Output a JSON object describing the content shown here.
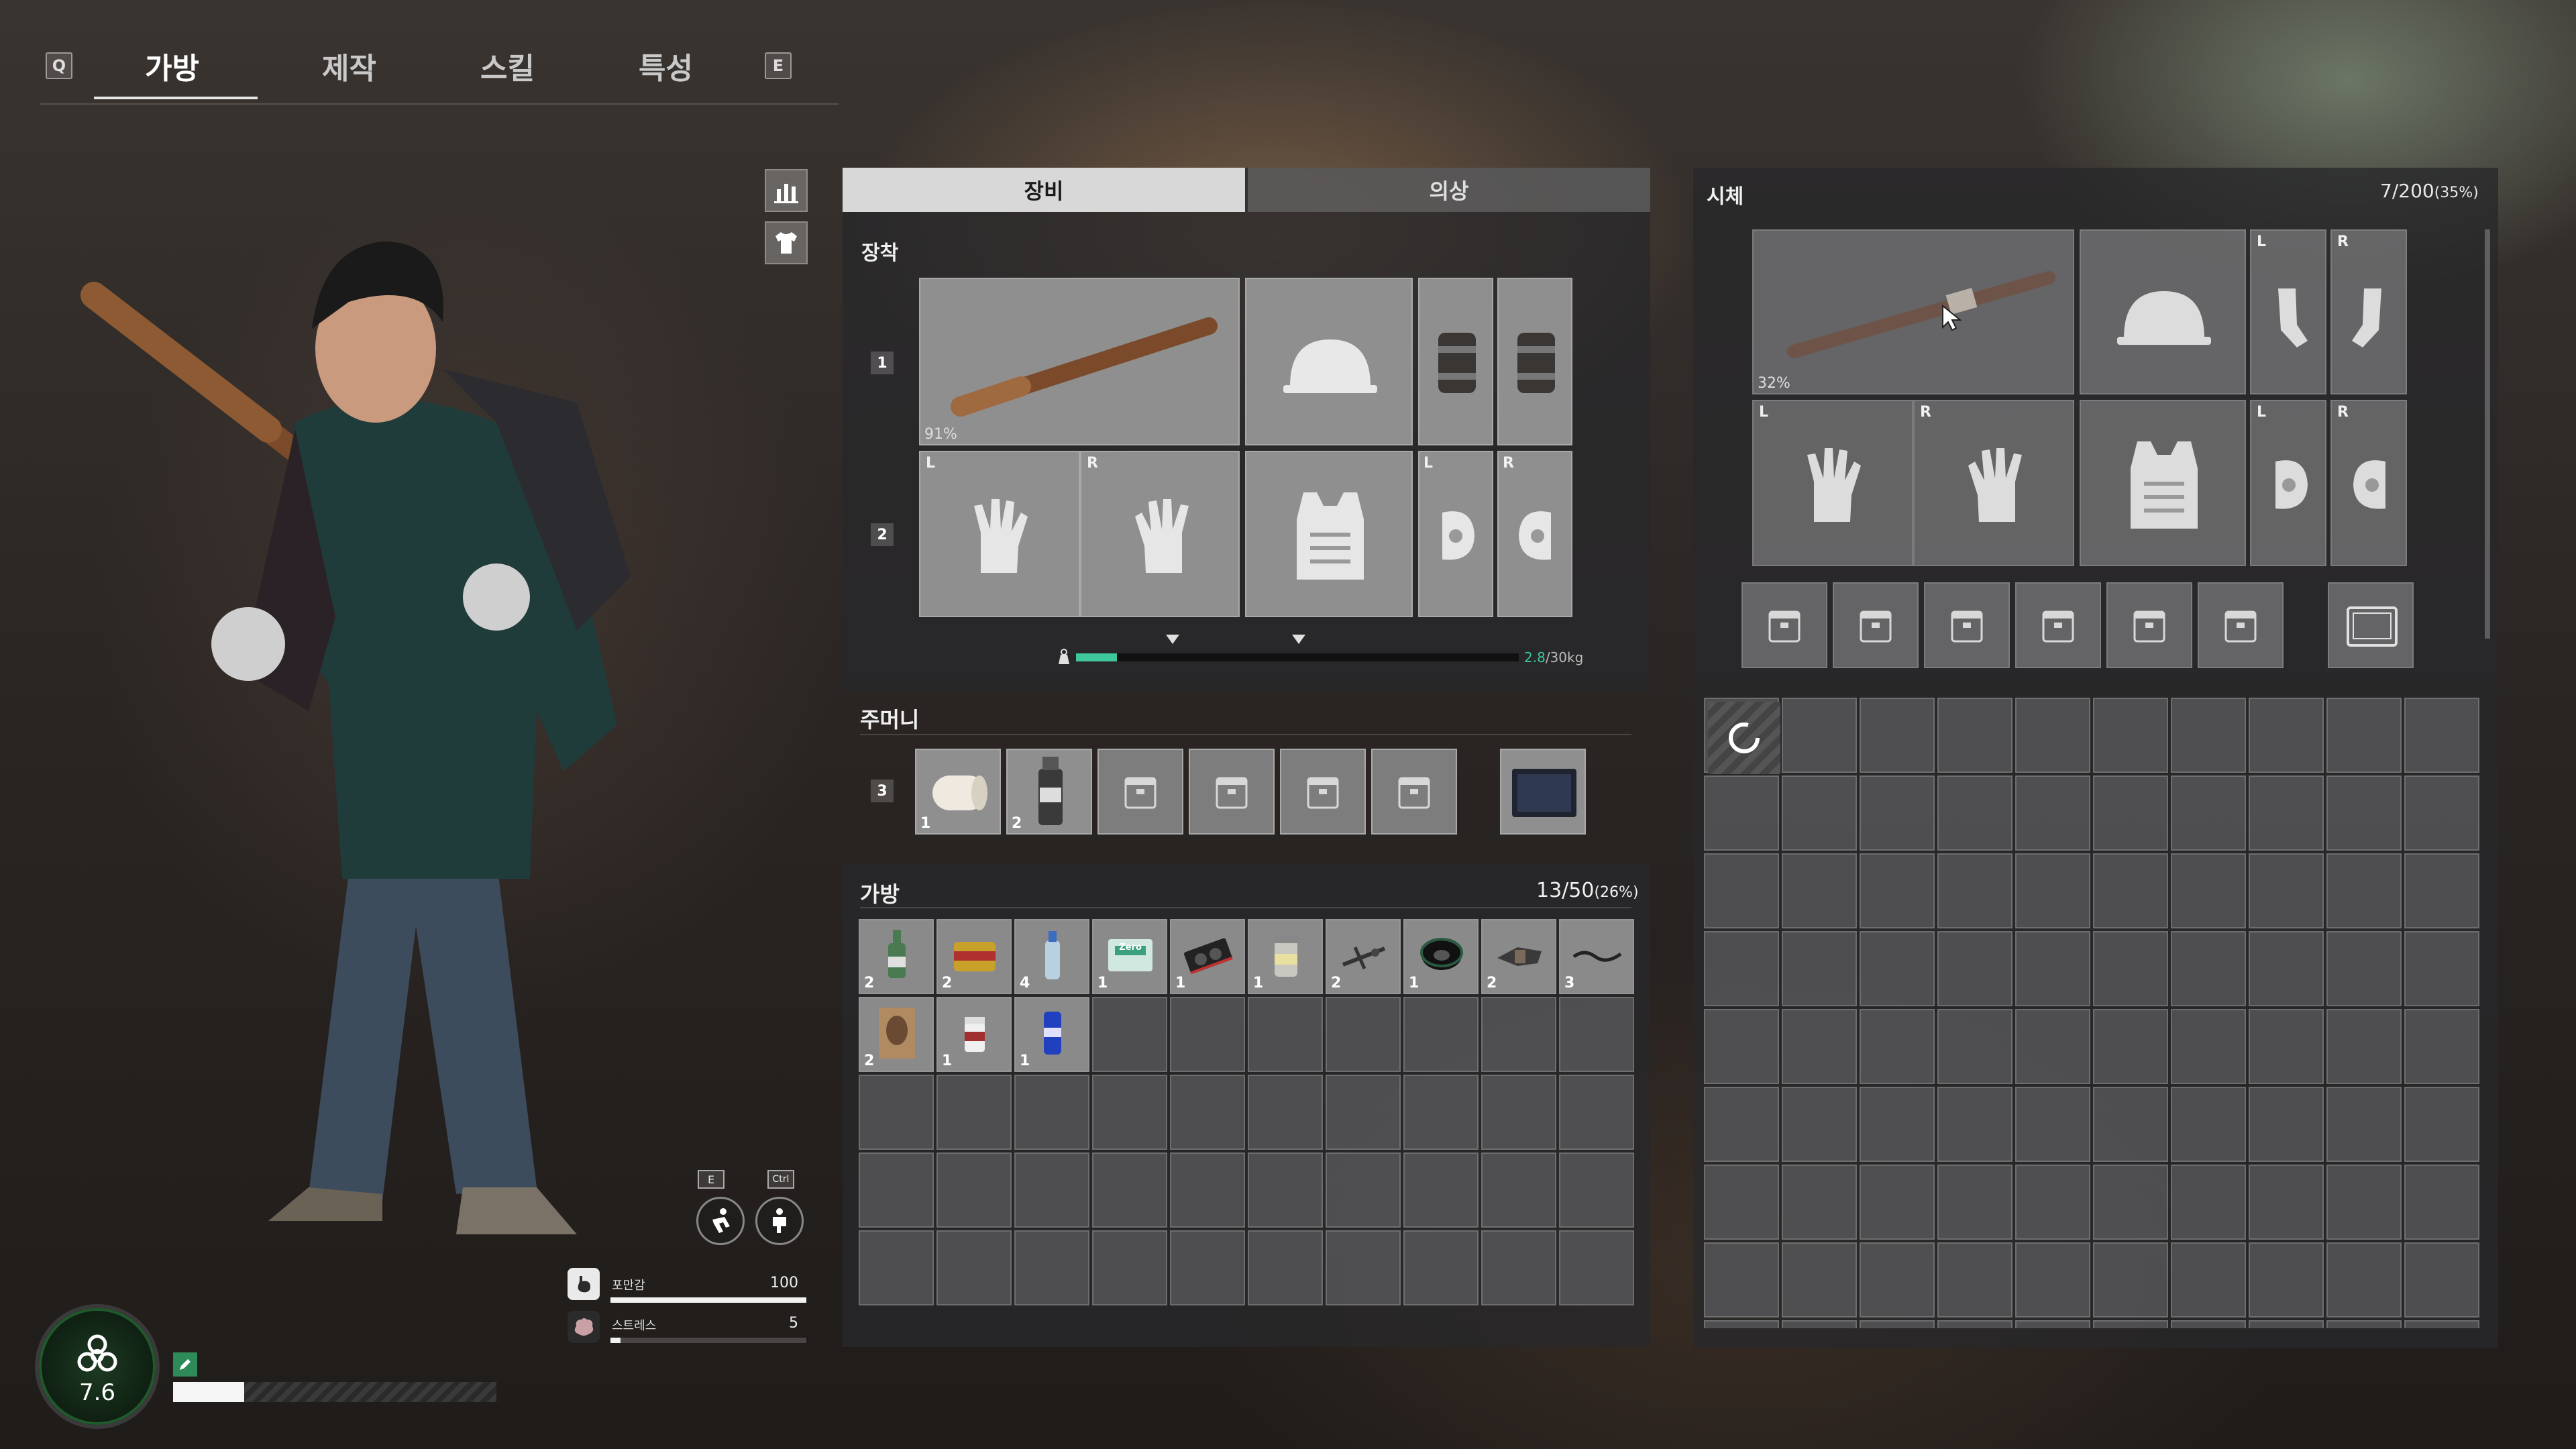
{
  "top_tabs": {
    "left_key": "Q",
    "right_key": "E",
    "items": [
      "가방",
      "제작",
      "스킬",
      "특성"
    ],
    "active": "가방"
  },
  "equipment_panel": {
    "tabs": [
      "장비",
      "의상"
    ],
    "active_tab": "장비",
    "section_equip": "장착",
    "row1_number": "1",
    "row2_number": "2",
    "weapon_durability": "91%",
    "lr_left": "L",
    "lr_right": "R",
    "weight_current": "2.8",
    "weight_max": "/30kg",
    "weight_fraction": 0.093
  },
  "pocket": {
    "title": "주머니",
    "row_number": "3",
    "items": [
      {
        "icon": "bandage-icon",
        "count": "1"
      },
      {
        "icon": "smoke-grenade-icon",
        "count": "2"
      }
    ]
  },
  "bag": {
    "title": "가방",
    "capacity": "13/50",
    "capacity_pct": "(26%)",
    "items": [
      {
        "icon": "soju-bottle-icon",
        "count": "2"
      },
      {
        "icon": "canned-ham-icon",
        "count": "2"
      },
      {
        "icon": "water-bottle-icon",
        "count": "4"
      },
      {
        "icon": "snack-pack-icon",
        "count": "1",
        "label": "Zero"
      },
      {
        "icon": "graphics-card-icon",
        "count": "1"
      },
      {
        "icon": "jar-icon",
        "count": "1"
      },
      {
        "icon": "scrap-parts-icon",
        "count": "2"
      },
      {
        "icon": "tape-roll-icon",
        "count": "1"
      },
      {
        "icon": "holster-icon",
        "count": "2"
      },
      {
        "icon": "cable-icon",
        "count": "3"
      },
      {
        "icon": "magazine-icon",
        "count": "2"
      },
      {
        "icon": "pill-bottle-icon",
        "count": "1"
      },
      {
        "icon": "energy-can-icon",
        "count": "1"
      }
    ]
  },
  "corpse_panel": {
    "title": "시체",
    "capacity": "7/200",
    "capacity_pct": "(35%)",
    "weapon_durability": "32%",
    "lr_left": "L",
    "lr_right": "R"
  },
  "character_status": {
    "infection_value": "7.6",
    "stat_rows": [
      {
        "icon": "stomach-icon",
        "label": "포만감",
        "value": "100",
        "fill": 1.0
      },
      {
        "icon": "brain-icon",
        "label": "스트레스",
        "value": "5",
        "fill": 0.05
      }
    ],
    "action_keys": [
      {
        "key": "E",
        "icon": "dodge-icon"
      },
      {
        "key": "Ctrl",
        "icon": "crouch-icon"
      }
    ],
    "stamina_fill": 0.22
  },
  "colors": {
    "accent_green": "#3ec79a",
    "panel_bg": "#2a2a2c",
    "cell_bg": "#6a6a6c",
    "equip_cell_bg": "#8f8f90"
  }
}
